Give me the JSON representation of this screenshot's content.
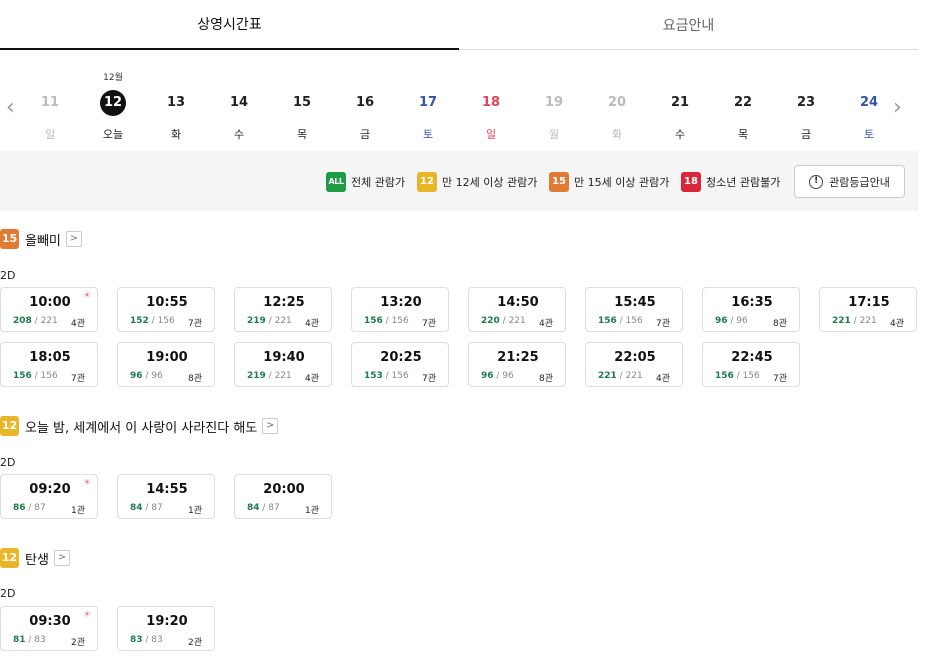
{
  "tabs": [
    {
      "label": "상영시간표",
      "active": true
    },
    {
      "label": "요금안내",
      "active": false
    }
  ],
  "dates": [
    {
      "month": "",
      "day": "11",
      "weekday": "일",
      "state": "dis"
    },
    {
      "month": "12월",
      "day": "12",
      "weekday": "오늘",
      "state": "sel"
    },
    {
      "month": "",
      "day": "13",
      "weekday": "화",
      "state": ""
    },
    {
      "month": "",
      "day": "14",
      "weekday": "수",
      "state": ""
    },
    {
      "month": "",
      "day": "15",
      "weekday": "목",
      "state": ""
    },
    {
      "month": "",
      "day": "16",
      "weekday": "금",
      "state": ""
    },
    {
      "month": "",
      "day": "17",
      "weekday": "토",
      "state": "sat"
    },
    {
      "month": "",
      "day": "18",
      "weekday": "일",
      "state": "sun"
    },
    {
      "month": "",
      "day": "19",
      "weekday": "월",
      "state": "dis"
    },
    {
      "month": "",
      "day": "20",
      "weekday": "화",
      "state": "dis"
    },
    {
      "month": "",
      "day": "21",
      "weekday": "수",
      "state": ""
    },
    {
      "month": "",
      "day": "22",
      "weekday": "목",
      "state": ""
    },
    {
      "month": "",
      "day": "23",
      "weekday": "금",
      "state": ""
    },
    {
      "month": "",
      "day": "24",
      "weekday": "토",
      "state": "sat"
    }
  ],
  "ratings": {
    "all": {
      "badge": "ALL",
      "label": "전체 관람가"
    },
    "r12": {
      "badge": "12",
      "label": "만 12세 이상 관람가"
    },
    "r15": {
      "badge": "15",
      "label": "만 15세 이상 관람가"
    },
    "r18": {
      "badge": "18",
      "label": "청소년 관람불가"
    },
    "guide_button": "관람등급안내"
  },
  "movies": [
    {
      "rating": "15",
      "title": "올빼미",
      "format": "2D",
      "showtimes": [
        {
          "time": "10:00",
          "remain": "208",
          "total": "221",
          "hall": "4관",
          "morning": true
        },
        {
          "time": "10:55",
          "remain": "152",
          "total": "156",
          "hall": "7관",
          "morning": false
        },
        {
          "time": "12:25",
          "remain": "219",
          "total": "221",
          "hall": "4관",
          "morning": false
        },
        {
          "time": "13:20",
          "remain": "156",
          "total": "156",
          "hall": "7관",
          "morning": false
        },
        {
          "time": "14:50",
          "remain": "220",
          "total": "221",
          "hall": "4관",
          "morning": false
        },
        {
          "time": "15:45",
          "remain": "156",
          "total": "156",
          "hall": "7관",
          "morning": false
        },
        {
          "time": "16:35",
          "remain": "96",
          "total": "96",
          "hall": "8관",
          "morning": false
        },
        {
          "time": "17:15",
          "remain": "221",
          "total": "221",
          "hall": "4관",
          "morning": false
        },
        {
          "time": "18:05",
          "remain": "156",
          "total": "156",
          "hall": "7관",
          "morning": false
        },
        {
          "time": "19:00",
          "remain": "96",
          "total": "96",
          "hall": "8관",
          "morning": false
        },
        {
          "time": "19:40",
          "remain": "219",
          "total": "221",
          "hall": "4관",
          "morning": false
        },
        {
          "time": "20:25",
          "remain": "153",
          "total": "156",
          "hall": "7관",
          "morning": false
        },
        {
          "time": "21:25",
          "remain": "96",
          "total": "96",
          "hall": "8관",
          "morning": false
        },
        {
          "time": "22:05",
          "remain": "221",
          "total": "221",
          "hall": "4관",
          "morning": false
        },
        {
          "time": "22:45",
          "remain": "156",
          "total": "156",
          "hall": "7관",
          "morning": false
        }
      ]
    },
    {
      "rating": "12",
      "title": "오늘 밤, 세계에서 이 사랑이 사라진다 해도",
      "format": "2D",
      "showtimes": [
        {
          "time": "09:20",
          "remain": "86",
          "total": "87",
          "hall": "1관",
          "morning": true
        },
        {
          "time": "14:55",
          "remain": "84",
          "total": "87",
          "hall": "1관",
          "morning": false
        },
        {
          "time": "20:00",
          "remain": "84",
          "total": "87",
          "hall": "1관",
          "morning": false
        }
      ]
    },
    {
      "rating": "12",
      "title": "탄생",
      "format": "2D",
      "showtimes": [
        {
          "time": "09:30",
          "remain": "81",
          "total": "83",
          "hall": "2관",
          "morning": true
        },
        {
          "time": "19:20",
          "remain": "83",
          "total": "83",
          "hall": "2관",
          "morning": false
        }
      ]
    }
  ],
  "icons": {
    "prev": "chevron-left-icon",
    "next": "chevron-right-icon",
    "morning": "sun-icon",
    "info": "info-icon",
    "detail": "chevron-right-icon"
  },
  "colors": {
    "all": "#1f9a45",
    "r12": "#e9b529",
    "r15": "#e07b33",
    "r18": "#d8263a",
    "saturday": "#3654a4",
    "sunday": "#e3445a",
    "remain_seats": "#1f7a4c"
  }
}
